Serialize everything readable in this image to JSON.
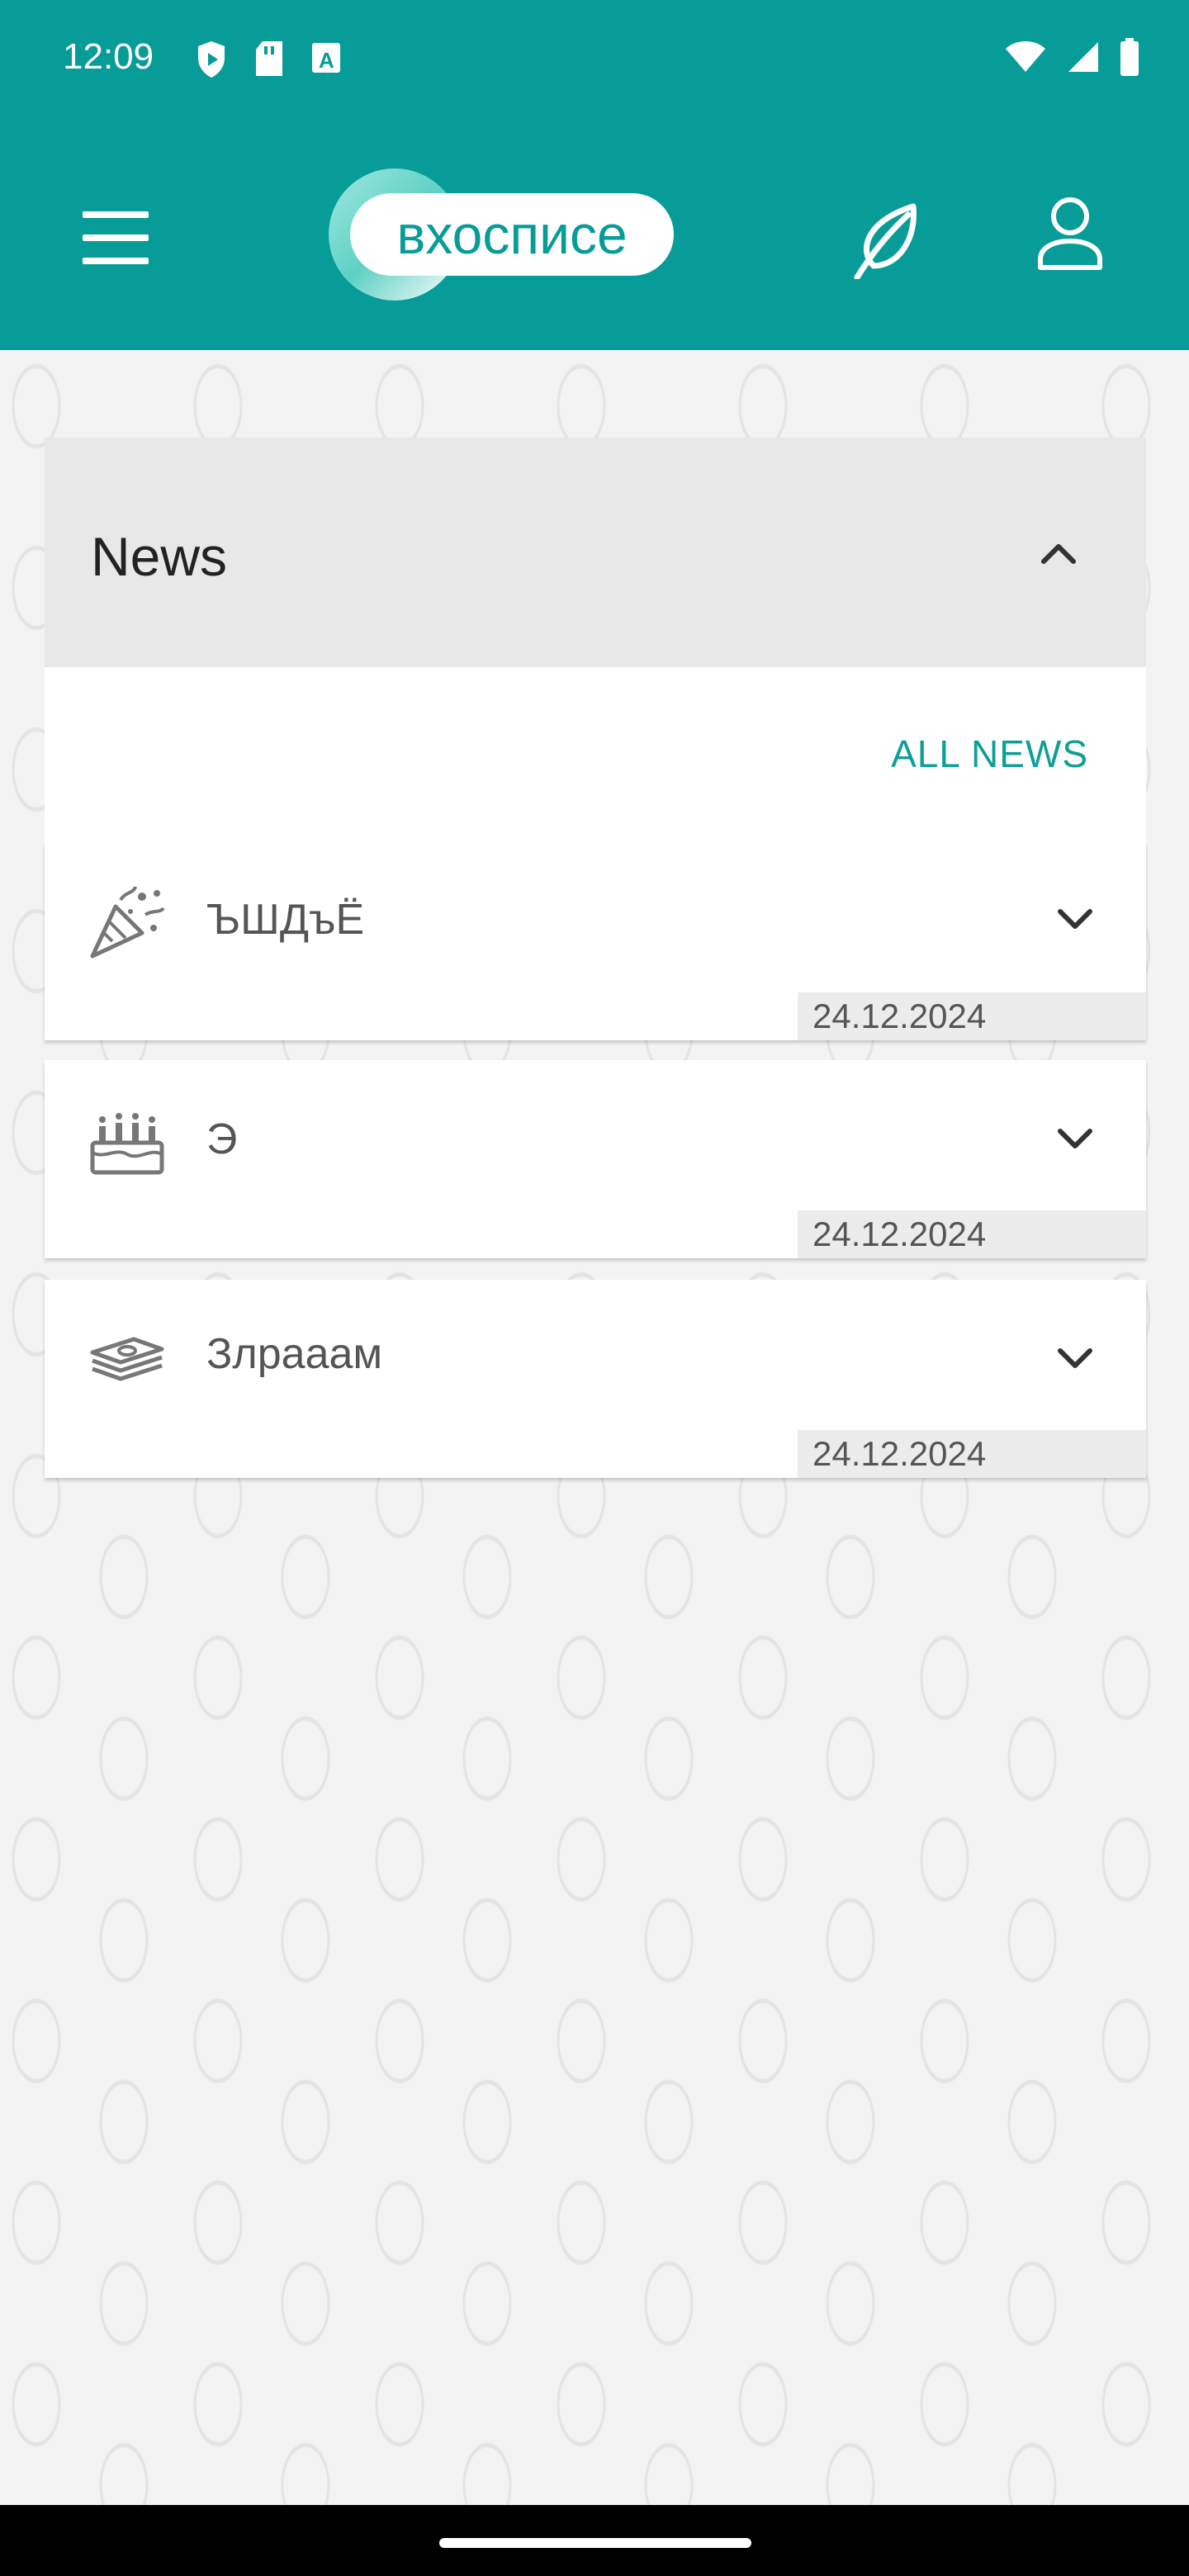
{
  "status_bar": {
    "time": "12:09",
    "icons_left": [
      "shield-icon",
      "sd-card-icon",
      "text-a-icon"
    ],
    "icons_right": [
      "wifi-icon",
      "signal-icon",
      "battery-icon"
    ]
  },
  "app_bar": {
    "logo_text": "вхосписе",
    "icons": [
      "menu-icon",
      "leaf-icon",
      "user-icon"
    ],
    "color": "#079c97"
  },
  "news": {
    "title": "News",
    "all_news_label": "ALL NEWS",
    "items": [
      {
        "icon": "party-popper-icon",
        "title": "ЪШДъЁ",
        "date": "24.12.2024"
      },
      {
        "icon": "cake-icon",
        "title": "Э",
        "date": "24.12.2024"
      },
      {
        "icon": "money-stack-icon",
        "title": "Злрааам",
        "date": "24.12.2024"
      }
    ]
  }
}
